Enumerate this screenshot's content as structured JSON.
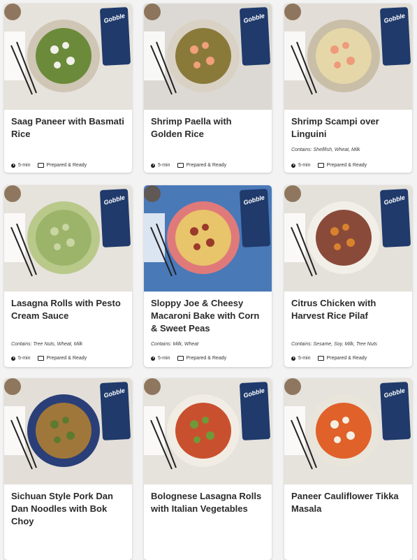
{
  "brand_name": "Gobble",
  "meal_time": "5-min",
  "meal_type": "Prepared & Ready",
  "cards": [
    {
      "title": "Saag Paneer with Basmati Rice",
      "contains": "",
      "bg": "#e6e2dc",
      "plate": "#cfc6b5",
      "food": "#6b8b3a",
      "accent": "#f2f0ea"
    },
    {
      "title": "Shrimp Paella with Golden Rice",
      "contains": "",
      "bg": "#dcd9d4",
      "plate": "#d9d2c4",
      "food": "#8a7a3a",
      "accent": "#f0a07a"
    },
    {
      "title": "Shrimp Scampi over Linguini",
      "contains": "Contains: Shellfish, Wheat, Milk",
      "bg": "#e2ddd6",
      "plate": "#c9bfa8",
      "food": "#e6d7a8",
      "accent": "#ef9a7a"
    },
    {
      "title": "Lasagna Rolls with Pesto Cream Sauce",
      "contains": "Contains: Tree Nuts, Wheat, Milk",
      "bg": "#e6e2dc",
      "plate": "#b9c98a",
      "food": "#9bb46a",
      "accent": "#c9d6a2"
    },
    {
      "title": "Sloppy Joe & Cheesy Macaroni Bake with Corn & Sweet Peas",
      "contains": "Contains: Milk, Wheat",
      "bg": "#4a79b8",
      "plate": "#e07a7a",
      "food": "#e8c46a",
      "accent": "#9a3a2a"
    },
    {
      "title": "Citrus Chicken with Harvest Rice Pilaf",
      "contains": "Contains: Sesame, Soy, Milk, Tree Nuts",
      "bg": "#e4e1db",
      "plate": "#f2efe8",
      "food": "#8a4a3a",
      "accent": "#d9822e"
    },
    {
      "title": "Sichuan Style Pork Dan Dan Noodles with Bok Choy",
      "contains": "",
      "bg": "#e3dfd8",
      "plate": "#2a3f78",
      "food": "#a0773a",
      "accent": "#5e7a2e"
    },
    {
      "title": "Bolognese Lasagna Rolls with Italian Vegetables",
      "contains": "",
      "bg": "#e6e2dc",
      "plate": "#f1ede4",
      "food": "#c9502e",
      "accent": "#6e9a3a"
    },
    {
      "title": "Paneer Cauliflower Tikka Masala",
      "contains": "",
      "bg": "#e6e2dc",
      "plate": "#eae5da",
      "food": "#e0612a",
      "accent": "#f4efe2"
    }
  ]
}
